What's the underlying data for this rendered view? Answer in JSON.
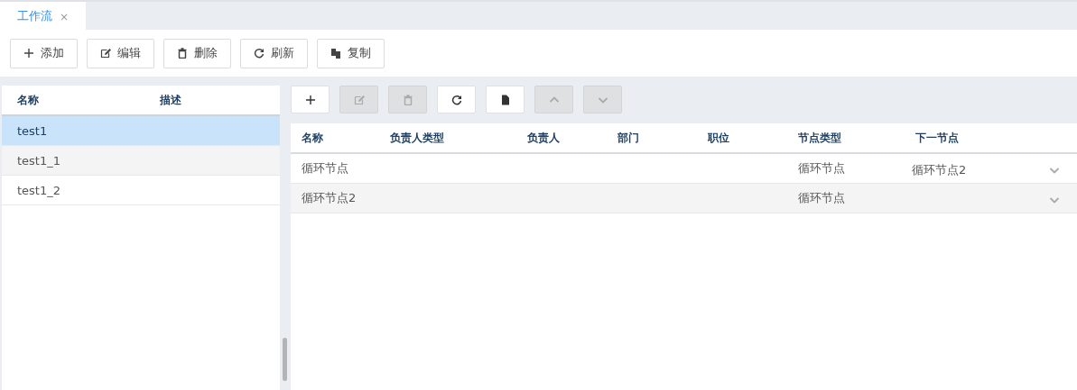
{
  "tabs": [
    {
      "label": "工作流",
      "selected": true,
      "close": "×"
    }
  ],
  "toolbar": [
    {
      "kind": "plus",
      "label": "添加"
    },
    {
      "kind": "edit",
      "label": "编辑"
    },
    {
      "kind": "trash",
      "label": "删除"
    },
    {
      "kind": "refresh",
      "label": "刷新"
    },
    {
      "kind": "copy",
      "label": "复制"
    }
  ],
  "workflow_list": {
    "columns": [
      "名称",
      "描述"
    ],
    "rows": [
      {
        "name": "test1",
        "selected": true
      },
      {
        "name": "test1_1",
        "selected": false
      },
      {
        "name": "test1_2",
        "selected": false
      }
    ]
  },
  "node_toolbar": [
    {
      "kind": "plus",
      "disabled": false
    },
    {
      "kind": "edit",
      "disabled": true
    },
    {
      "kind": "trash",
      "disabled": true
    },
    {
      "kind": "refresh",
      "disabled": false
    },
    {
      "kind": "file",
      "disabled": false
    },
    {
      "kind": "up",
      "disabled": true
    },
    {
      "kind": "down",
      "disabled": true
    }
  ],
  "node_table": {
    "columns": [
      "名称",
      "负责人类型",
      "负责人",
      "部门",
      "职位",
      "节点类型",
      "下一节点"
    ],
    "rows": [
      {
        "name": "循环节点",
        "node_type": "循环节点",
        "next_node": "循环节点2"
      },
      {
        "name": "循环节点2",
        "node_type": "循环节点"
      }
    ]
  }
}
